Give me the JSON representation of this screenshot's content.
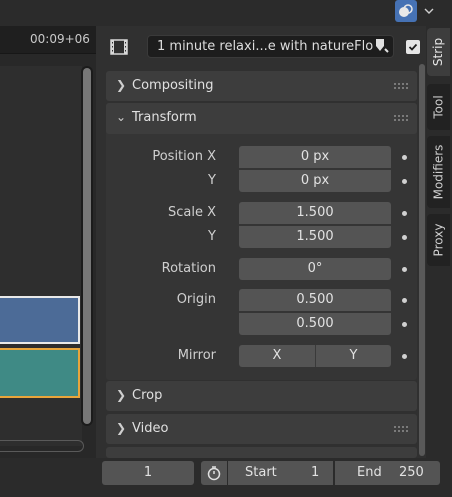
{
  "timeline": {
    "timecode": "00:09+06"
  },
  "strip": {
    "name": "1 minute relaxi...e with natureFlo",
    "enabled": true
  },
  "sections": {
    "compositing": "Compositing",
    "transform": "Transform",
    "crop": "Crop",
    "video": "Video"
  },
  "transform": {
    "position_label": "Position X",
    "position_y_label": "Y",
    "position_x": "0 px",
    "position_y": "0 px",
    "scale_label": "Scale X",
    "scale_y_label": "Y",
    "scale_x": "1.500",
    "scale_y": "1.500",
    "rotation_label": "Rotation",
    "rotation": "0°",
    "origin_label": "Origin",
    "origin_x": "0.500",
    "origin_y": "0.500",
    "mirror_label": "Mirror",
    "mirror_x": "X",
    "mirror_y": "Y"
  },
  "tabs": [
    "Strip",
    "Tool",
    "Modifiers",
    "Proxy"
  ],
  "footer": {
    "current_frame": "1",
    "start_label": "Start",
    "start_value": "1",
    "end_label": "End",
    "end_value": "250"
  },
  "colors": {
    "accent": "#4672b4",
    "strip_image": "#4c6b97",
    "strip_movie": "#3f8a85",
    "strip_selected_outline": "#e9a53b"
  },
  "icons": [
    "overlay-icon",
    "chevron-down-icon",
    "strip-filmstrip-icon",
    "color-tag-icon",
    "checkmark-icon",
    "stopwatch-icon",
    "grip-icon"
  ]
}
